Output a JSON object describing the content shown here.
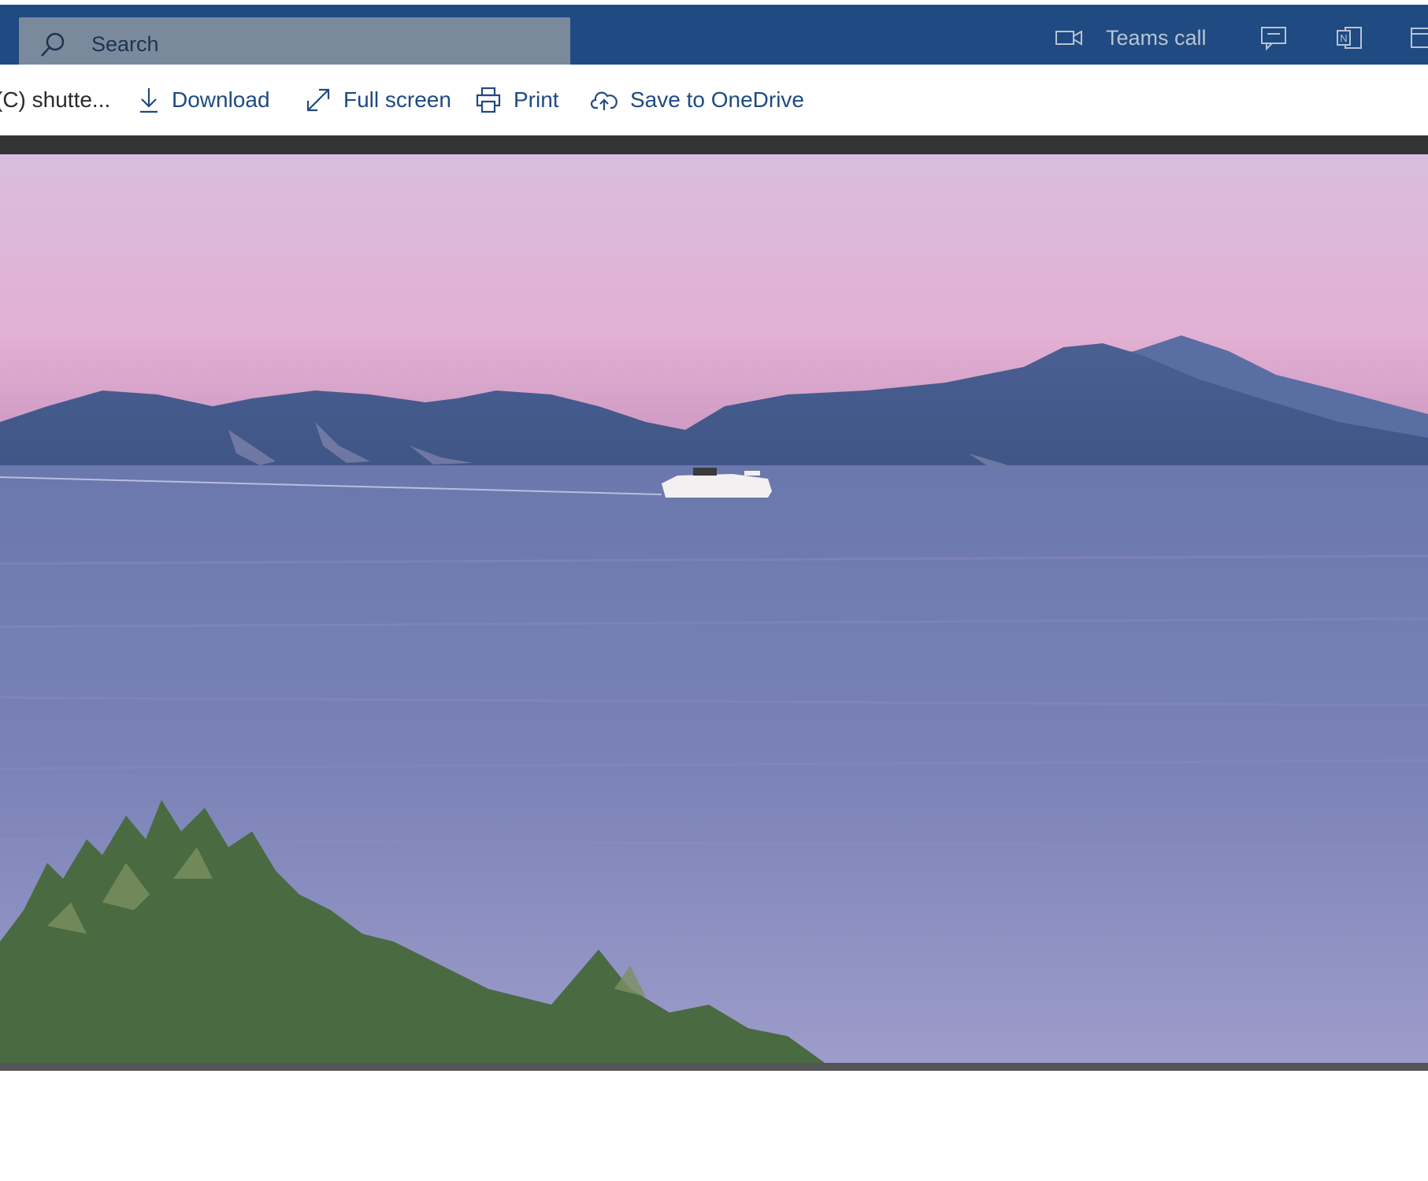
{
  "search": {
    "placeholder": "Search",
    "icon": "search-icon"
  },
  "top_actions": {
    "teams_call_label": "Teams call",
    "teams_call_icon": "video-camera-icon",
    "chat_icon": "chat-icon",
    "onenote_icon": "onenote-icon",
    "calendar_icon": "calendar-icon"
  },
  "toolbar": {
    "file_name": "(C) shutte...",
    "download_label": "Download",
    "fullscreen_label": "Full screen",
    "print_label": "Print",
    "onedrive_label": "Save to OneDrive",
    "download_icon": "download-icon",
    "fullscreen_icon": "expand-icon",
    "print_icon": "printer-icon",
    "onedrive_icon": "cloud-upload-icon"
  },
  "colors": {
    "top_bar": "#1f4a82",
    "search_box": "#7a8a9c",
    "toolbar_text": "#1f4a82",
    "viewer_background": "#333333",
    "sky_top": "#d9bde0",
    "sky_bottom": "#cf93c4",
    "mountains": "#3f5a8a",
    "sea": "#6b73a8"
  },
  "image": {
    "description_icon": "landscape-photo"
  }
}
